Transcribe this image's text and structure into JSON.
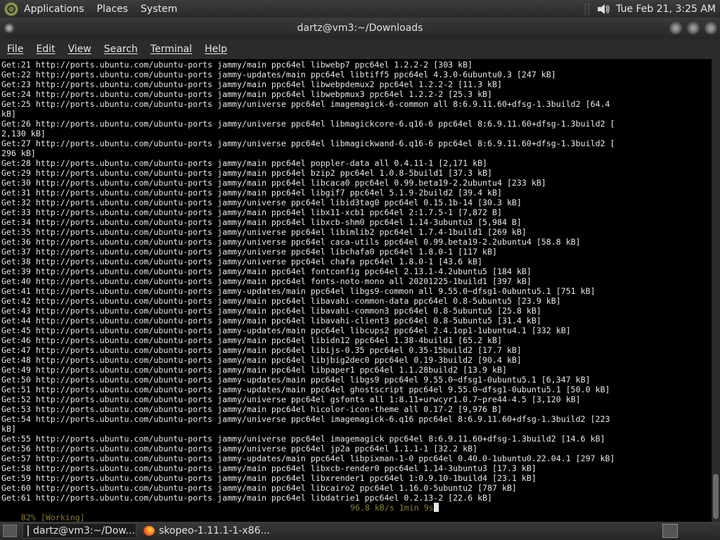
{
  "top_panel": {
    "menus": [
      "Applications",
      "Places",
      "System"
    ],
    "clock": "Tue Feb 21,  3:25 AM"
  },
  "window": {
    "title": "dartz@vm3:~/Downloads",
    "menu": [
      "File",
      "Edit",
      "View",
      "Search",
      "Terminal",
      "Help"
    ]
  },
  "terminal": {
    "lines": [
      "Get:21 http://ports.ubuntu.com/ubuntu-ports jammy/main ppc64el libwebp7 ppc64el 1.2.2-2 [303 kB]",
      "Get:22 http://ports.ubuntu.com/ubuntu-ports jammy-updates/main ppc64el libtiff5 ppc64el 4.3.0-6ubuntu0.3 [247 kB]",
      "Get:23 http://ports.ubuntu.com/ubuntu-ports jammy/main ppc64el libwebpdemux2 ppc64el 1.2.2-2 [11.3 kB]",
      "Get:24 http://ports.ubuntu.com/ubuntu-ports jammy/main ppc64el libwebpmux3 ppc64el 1.2.2-2 [25.3 kB]",
      "Get:25 http://ports.ubuntu.com/ubuntu-ports jammy/universe ppc64el imagemagick-6-common all 8:6.9.11.60+dfsg-1.3build2 [64.4",
      "kB]",
      "Get:26 http://ports.ubuntu.com/ubuntu-ports jammy/universe ppc64el libmagickcore-6.q16-6 ppc64el 8:6.9.11.60+dfsg-1.3build2 [",
      "2,130 kB]",
      "Get:27 http://ports.ubuntu.com/ubuntu-ports jammy/universe ppc64el libmagickwand-6.q16-6 ppc64el 8:6.9.11.60+dfsg-1.3build2 [",
      "296 kB]",
      "Get:28 http://ports.ubuntu.com/ubuntu-ports jammy/main ppc64el poppler-data all 0.4.11-1 [2,171 kB]",
      "Get:29 http://ports.ubuntu.com/ubuntu-ports jammy/main ppc64el bzip2 ppc64el 1.0.8-5build1 [37.3 kB]",
      "Get:30 http://ports.ubuntu.com/ubuntu-ports jammy/main ppc64el libcaca0 ppc64el 0.99.beta19-2.2ubuntu4 [233 kB]",
      "Get:31 http://ports.ubuntu.com/ubuntu-ports jammy/main ppc64el libgif7 ppc64el 5.1.9-2build2 [39.4 kB]",
      "Get:32 http://ports.ubuntu.com/ubuntu-ports jammy/universe ppc64el libid3tag0 ppc64el 0.15.1b-14 [30.3 kB]",
      "Get:33 http://ports.ubuntu.com/ubuntu-ports jammy/main ppc64el libx11-xcb1 ppc64el 2:1.7.5-1 [7,872 B]",
      "Get:34 http://ports.ubuntu.com/ubuntu-ports jammy/main ppc64el libxcb-shm0 ppc64el 1.14-3ubuntu3 [5,984 B]",
      "Get:35 http://ports.ubuntu.com/ubuntu-ports jammy/universe ppc64el libimlib2 ppc64el 1.7.4-1build1 [269 kB]",
      "Get:36 http://ports.ubuntu.com/ubuntu-ports jammy/universe ppc64el caca-utils ppc64el 0.99.beta19-2.2ubuntu4 [58.8 kB]",
      "Get:37 http://ports.ubuntu.com/ubuntu-ports jammy/universe ppc64el libchafa0 ppc64el 1.8.0-1 [117 kB]",
      "Get:38 http://ports.ubuntu.com/ubuntu-ports jammy/universe ppc64el chafa ppc64el 1.8.0-1 [43.6 kB]",
      "Get:39 http://ports.ubuntu.com/ubuntu-ports jammy/main ppc64el fontconfig ppc64el 2.13.1-4.2ubuntu5 [184 kB]",
      "Get:40 http://ports.ubuntu.com/ubuntu-ports jammy/main ppc64el fonts-noto-mono all 20201225-1build1 [397 kB]",
      "Get:41 http://ports.ubuntu.com/ubuntu-ports jammy-updates/main ppc64el libgs9-common all 9.55.0~dfsg1-0ubuntu5.1 [751 kB]",
      "Get:42 http://ports.ubuntu.com/ubuntu-ports jammy/main ppc64el libavahi-common-data ppc64el 0.8-5ubuntu5 [23.9 kB]",
      "Get:43 http://ports.ubuntu.com/ubuntu-ports jammy/main ppc64el libavahi-common3 ppc64el 0.8-5ubuntu5 [25.8 kB]",
      "Get:44 http://ports.ubuntu.com/ubuntu-ports jammy/main ppc64el libavahi-client3 ppc64el 0.8-5ubuntu5 [31.4 kB]",
      "Get:45 http://ports.ubuntu.com/ubuntu-ports jammy-updates/main ppc64el libcups2 ppc64el 2.4.1op1-1ubuntu4.1 [332 kB]",
      "Get:46 http://ports.ubuntu.com/ubuntu-ports jammy/main ppc64el libidn12 ppc64el 1.38-4build1 [65.2 kB]",
      "Get:47 http://ports.ubuntu.com/ubuntu-ports jammy/main ppc64el libijs-0.35 ppc64el 0.35-15build2 [17.7 kB]",
      "Get:48 http://ports.ubuntu.com/ubuntu-ports jammy/main ppc64el libjbig2dec0 ppc64el 0.19-3build2 [90.4 kB]",
      "Get:49 http://ports.ubuntu.com/ubuntu-ports jammy/main ppc64el libpaper1 ppc64el 1.1.28build2 [13.9 kB]",
      "Get:50 http://ports.ubuntu.com/ubuntu-ports jammy-updates/main ppc64el libgs9 ppc64el 9.55.0~dfsg1-0ubuntu5.1 [6,347 kB]",
      "Get:51 http://ports.ubuntu.com/ubuntu-ports jammy-updates/main ppc64el ghostscript ppc64el 9.55.0~dfsg1-0ubuntu5.1 [50.0 kB]",
      "Get:52 http://ports.ubuntu.com/ubuntu-ports jammy/universe ppc64el gsfonts all 1:8.11+urwcyr1.0.7~pre44-4.5 [3,120 kB]",
      "Get:53 http://ports.ubuntu.com/ubuntu-ports jammy/main ppc64el hicolor-icon-theme all 0.17-2 [9,976 B]",
      "Get:54 http://ports.ubuntu.com/ubuntu-ports jammy/universe ppc64el imagemagick-6.q16 ppc64el 8:6.9.11.60+dfsg-1.3build2 [223",
      "kB]",
      "Get:55 http://ports.ubuntu.com/ubuntu-ports jammy/universe ppc64el imagemagick ppc64el 8:6.9.11.60+dfsg-1.3build2 [14.6 kB]",
      "Get:56 http://ports.ubuntu.com/ubuntu-ports jammy/universe ppc64el jp2a ppc64el 1.1.1-1 [32.2 kB]",
      "Get:57 http://ports.ubuntu.com/ubuntu-ports jammy-updates/main ppc64el libpixman-1-0 ppc64el 0.40.0-1ubuntu0.22.04.1 [297 kB]",
      "Get:58 http://ports.ubuntu.com/ubuntu-ports jammy/main ppc64el libxcb-render0 ppc64el 1.14-3ubuntu3 [17.3 kB]",
      "Get:59 http://ports.ubuntu.com/ubuntu-ports jammy/main ppc64el libxrender1 ppc64el 1:0.9.10-1build4 [23.1 kB]",
      "Get:60 http://ports.ubuntu.com/ubuntu-ports jammy/main ppc64el libcairo2 ppc64el 1.16.0-5ubuntu2 [787 kB]",
      "Get:61 http://ports.ubuntu.com/ubuntu-ports jammy/main ppc64el libdatrie1 ppc64el 0.2.13-2 [22.6 kB]"
    ],
    "status_progress": "82% [Working]",
    "status_rate": "96.8 kB/s 1min 9s"
  },
  "taskbar": {
    "tasks": [
      "dartz@vm3:~/Dow...",
      "skopeo-1.11.1-1-x86..."
    ]
  },
  "colors": {
    "terminal_bg": "#000000",
    "terminal_fg": "#e8e8e8",
    "status_fg": "#8a7c2a",
    "panel_bg": "#2b2b2b"
  },
  "icons": [
    "menu-logo-icon",
    "volume-icon",
    "window-menu-icon",
    "minimize-icon",
    "maximize-icon",
    "close-icon",
    "terminal-icon",
    "firefox-icon",
    "workspace-icon"
  ]
}
